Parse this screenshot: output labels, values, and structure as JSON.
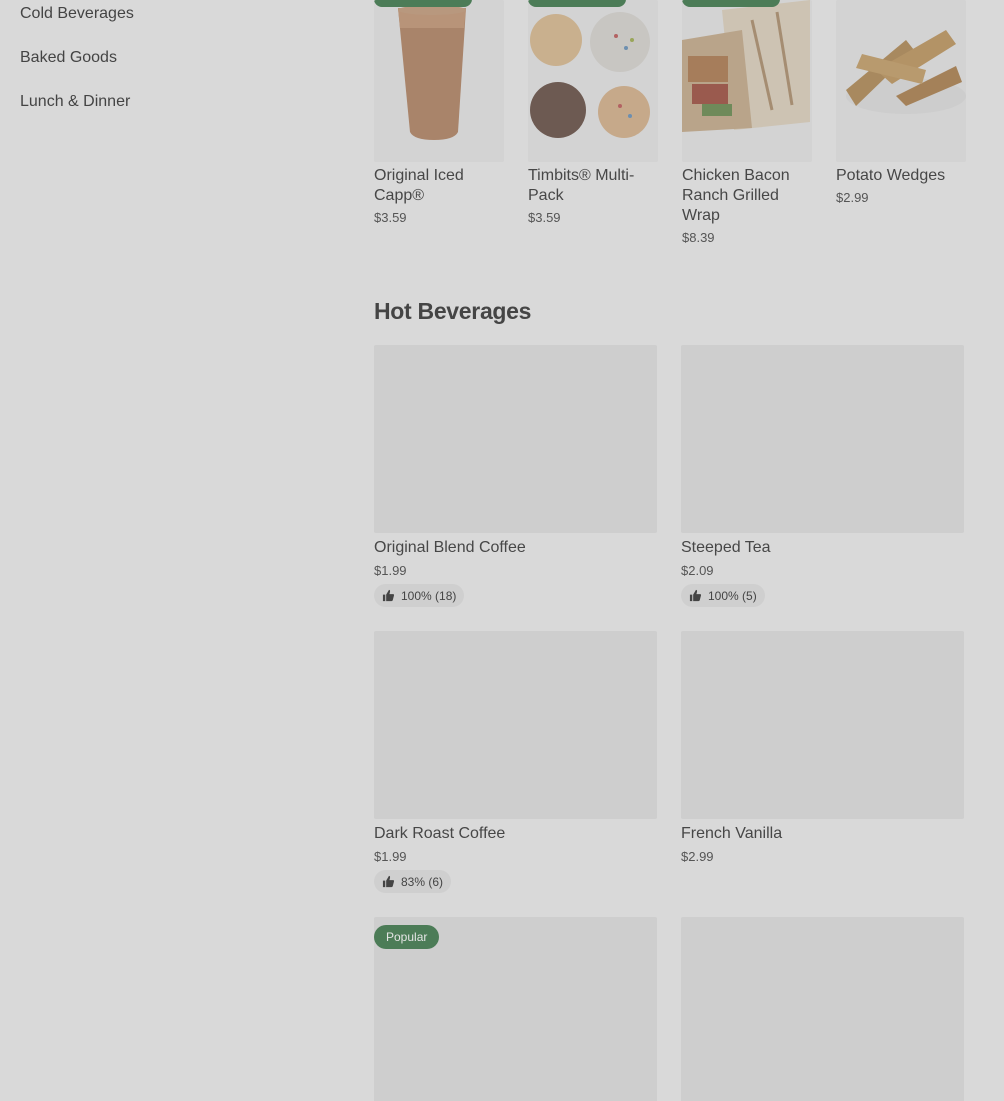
{
  "sidebar": {
    "items": [
      {
        "label": "Cold Beverages"
      },
      {
        "label": "Baked Goods"
      },
      {
        "label": "Lunch & Dinner"
      }
    ]
  },
  "top_items": [
    {
      "title": "Original Iced Capp®",
      "price": "$3.59"
    },
    {
      "title": "Timbits® Multi-Pack",
      "price": "$3.59"
    },
    {
      "title": "Chicken Bacon Ranch Grilled Wrap",
      "price": "$8.39"
    },
    {
      "title": "Potato Wedges",
      "price": "$2.99"
    }
  ],
  "section": {
    "title": "Hot Beverages"
  },
  "hot_items": [
    {
      "title": "Original Blend Coffee",
      "price": "$1.99",
      "rating": "100% (18)"
    },
    {
      "title": "Steeped Tea",
      "price": "$2.09",
      "rating": "100% (5)"
    },
    {
      "title": "Dark Roast Coffee",
      "price": "$1.99",
      "rating": "83% (6)"
    },
    {
      "title": "French Vanilla",
      "price": "$2.99"
    },
    {
      "badge": "Popular"
    },
    {}
  ],
  "colors": {
    "accent": "#4c7c57",
    "overlay": "#d9d9d9"
  },
  "icons": {
    "rating": "thumbs-up-icon"
  }
}
